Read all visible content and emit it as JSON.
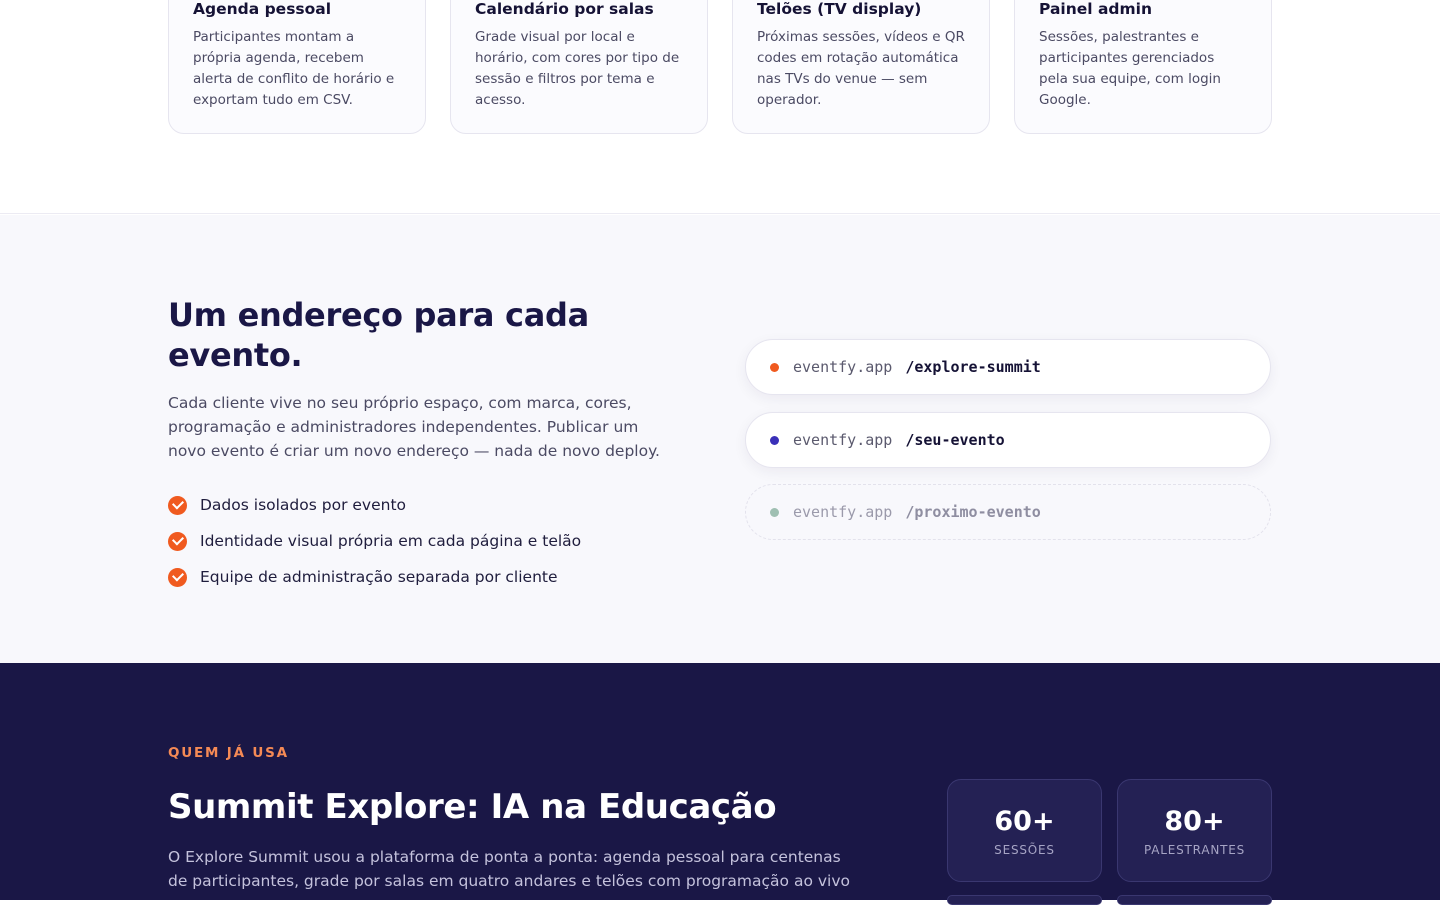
{
  "features": [
    {
      "title": "Agenda pessoal",
      "text": "Participantes montam a própria agenda, recebem alerta de conflito de horário e exportam tudo em CSV."
    },
    {
      "title": "Calendário por salas",
      "text": "Grade visual por local e horário, com cores por tipo de sessão e filtros por tema e acesso."
    },
    {
      "title": "Telões (TV display)",
      "text": "Próximas sessões, vídeos e QR codes em rotação automática nas TVs do venue — sem operador."
    },
    {
      "title": "Painel admin",
      "text": "Sessões, palestrantes e participantes gerenciados pela sua equipe, com login Google."
    }
  ],
  "address": {
    "heading": "Um endereço para cada evento.",
    "lead": "Cada cliente vive no seu próprio espaço, com marca, cores, programação e administradores independentes. Publicar um novo evento é criar um novo endereço — nada de novo deploy.",
    "checks": [
      "Dados isolados por evento",
      "Identidade visual própria em cada página e telão",
      "Equipe de administração separada por cliente"
    ],
    "urls": [
      {
        "host": "eventfy.app",
        "path": "/explore-summit",
        "dot_color": "#f05a1f"
      },
      {
        "host": "eventfy.app",
        "path": "/seu-evento",
        "dot_color": "#3a30b8"
      },
      {
        "host": "eventfy.app",
        "path": "/proximo-evento",
        "dot_color": "#9fbfb2"
      }
    ]
  },
  "case": {
    "eyebrow": "QUEM JÁ USA",
    "title": "Summit Explore: IA na Educação",
    "description": "O Explore Summit usou a plataforma de ponta a ponta: agenda pessoal para centenas de participantes, grade por salas em quatro andares e telões com programação ao vivo",
    "stats": [
      {
        "value": "60+",
        "label": "SESSÕES"
      },
      {
        "value": "80+",
        "label": "PALESTRANTES"
      }
    ]
  },
  "colors": {
    "accent": "#f05a1f",
    "navy": "#1a1746",
    "eyebrow": "#f58a55"
  }
}
